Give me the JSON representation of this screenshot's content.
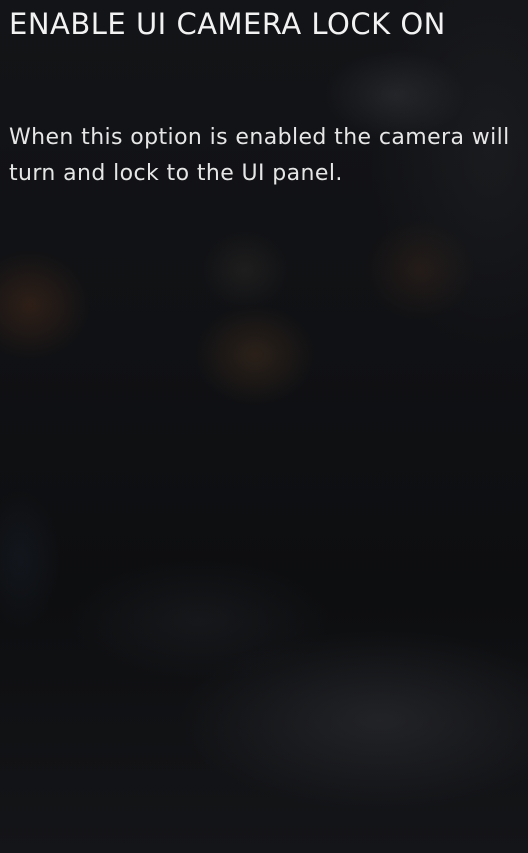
{
  "option_panel": {
    "title": "ENABLE UI CAMERA LOCK ON",
    "description": "When this option is enabled the camera will turn and lock to the UI panel."
  }
}
